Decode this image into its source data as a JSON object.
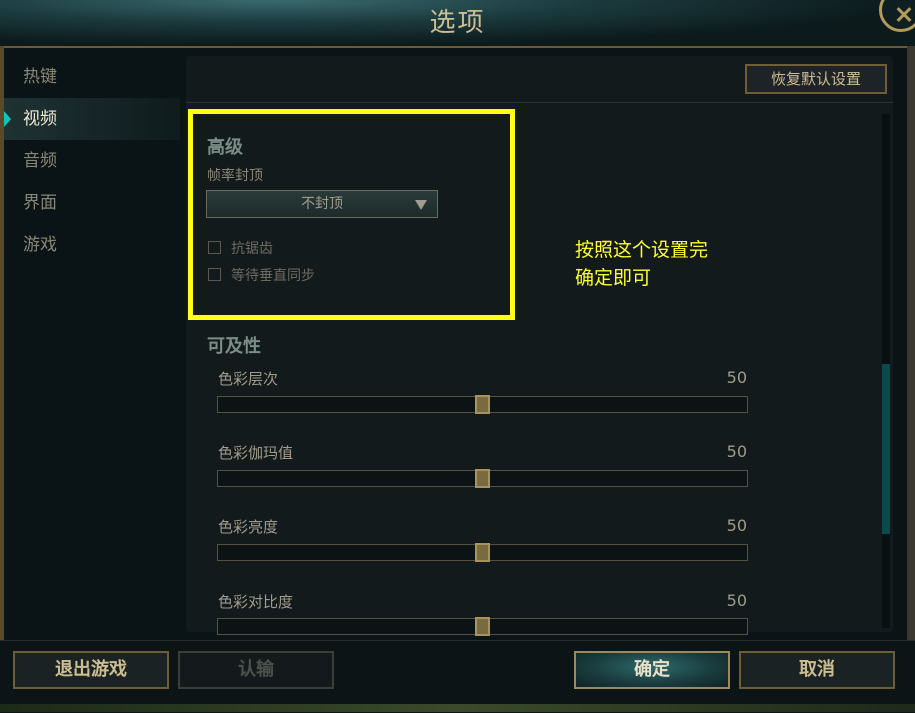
{
  "window": {
    "title": "选项"
  },
  "sidebar": {
    "items": [
      {
        "label": "热键"
      },
      {
        "label": "视频",
        "active": true
      },
      {
        "label": "音频"
      },
      {
        "label": "界面"
      },
      {
        "label": "游戏"
      }
    ]
  },
  "header": {
    "reset_label": "恢复默认设置"
  },
  "advanced": {
    "title": "高级",
    "fps_label": "帧率封顶",
    "fps_value": "不封顶",
    "checkboxes": [
      {
        "label": "抗锯齿",
        "checked": false
      },
      {
        "label": "等待垂直同步",
        "checked": false
      }
    ]
  },
  "accessibility": {
    "title": "可及性",
    "sliders": [
      {
        "label": "色彩层次",
        "value": "50",
        "fraction": 0.5
      },
      {
        "label": "色彩伽玛值",
        "value": "50",
        "fraction": 0.5
      },
      {
        "label": "色彩亮度",
        "value": "50",
        "fraction": 0.5
      },
      {
        "label": "色彩对比度",
        "value": "50",
        "fraction": 0.5
      }
    ]
  },
  "annotation": {
    "line1": "按照这个设置完",
    "line2": "确定即可"
  },
  "footer": {
    "exit_label": "退出游戏",
    "surrender_label": "认输",
    "ok_label": "确定",
    "cancel_label": "取消"
  },
  "colors": {
    "accent": "#0ac8b9",
    "gold": "#cdbe91",
    "highlight": "#ffff1a"
  }
}
